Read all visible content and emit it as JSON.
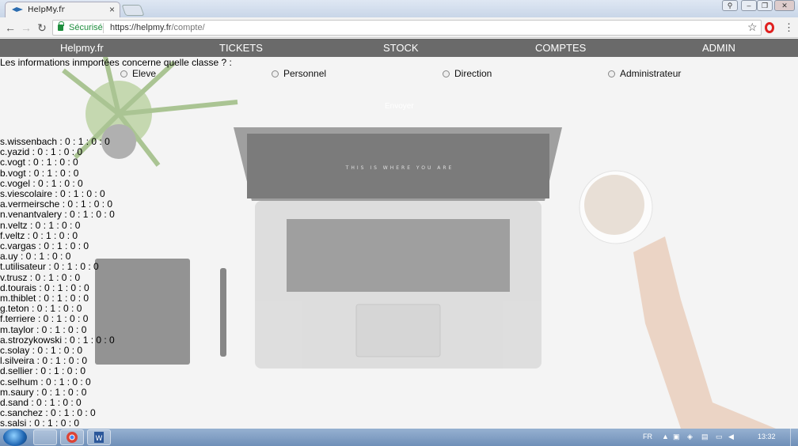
{
  "browser": {
    "tab_title": "HelpMy.fr",
    "tab_close": "×",
    "security_label": "Sécurisé",
    "url_host": "https://helpmy.fr",
    "url_path": "/compte/"
  },
  "navbar": {
    "brand": "Helpmy.fr",
    "items": [
      "TICKETS",
      "STOCK",
      "COMPTES",
      "ADMIN"
    ]
  },
  "form": {
    "question": "Les informations inmportées concerne quelle classe ? :",
    "options": [
      "Eleve",
      "Personnel",
      "Direction",
      "Administrateur"
    ],
    "submit_label": "Envoyer"
  },
  "accounts": [
    "s.wissenbach : 0 : 1 : 0 : 0",
    "c.yazid : 0 : 1 : 0 : 0",
    "c.vogt : 0 : 1 : 0 : 0",
    "b.vogt : 0 : 1 : 0 : 0",
    "c.vogel : 0 : 1 : 0 : 0",
    "s.viescolaire : 0 : 1 : 0 : 0",
    "a.vermeirsche : 0 : 1 : 0 : 0",
    "n.venantvalery : 0 : 1 : 0 : 0",
    "n.veltz : 0 : 1 : 0 : 0",
    "f.veltz : 0 : 1 : 0 : 0",
    "c.vargas : 0 : 1 : 0 : 0",
    "a.uy : 0 : 1 : 0 : 0",
    "t.utilisateur : 0 : 1 : 0 : 0",
    "v.trusz : 0 : 1 : 0 : 0",
    "d.tourais : 0 : 1 : 0 : 0",
    "m.thiblet : 0 : 1 : 0 : 0",
    "g.teton : 0 : 1 : 0 : 0",
    "f.terriere : 0 : 1 : 0 : 0",
    "m.taylor : 0 : 1 : 0 : 0",
    "a.strozykowski : 0 : 1 : 0 : 0",
    "c.solay : 0 : 1 : 0 : 0",
    "l.silveira : 0 : 1 : 0 : 0",
    "d.sellier : 0 : 1 : 0 : 0",
    "c.selhum : 0 : 1 : 0 : 0",
    "m.saury : 0 : 1 : 0 : 0",
    "d.sand : 0 : 1 : 0 : 0",
    "c.sanchez : 0 : 1 : 0 : 0",
    "s.salsi : 0 : 1 : 0 : 0"
  ],
  "taskbar": {
    "language": "FR",
    "clock": "13:32"
  },
  "icons": {
    "back": "back-arrow-icon",
    "forward": "forward-arrow-icon",
    "reload": "reload-icon",
    "bookmark": "star-icon",
    "opera": "opera-icon",
    "menu": "menu-dots-icon"
  },
  "colors": {
    "navbar": "#6a6a6a",
    "secure_green": "#1e8e3e"
  }
}
